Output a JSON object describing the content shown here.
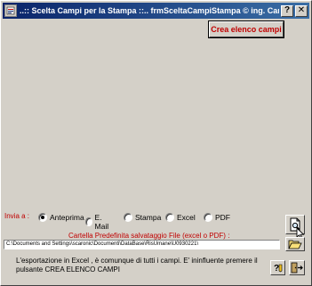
{
  "window": {
    "title": "..:: Scelta Campi per la Stampa ::..    frmSceltaCampiStampa © ing. Carlo Scaroni",
    "help_glyph": "?",
    "close_glyph": "✕"
  },
  "toolbar": {
    "crea_label": "Crea elenco campi"
  },
  "invia": {
    "label": "Invia a :",
    "options": [
      {
        "label": "Anteprima",
        "checked": true
      },
      {
        "label": "E. Mail",
        "checked": false
      },
      {
        "label": "Stampa",
        "checked": false
      },
      {
        "label": "Excel",
        "checked": false
      },
      {
        "label": "PDF",
        "checked": false
      }
    ]
  },
  "cartella": {
    "label": "Cartella Predefinita salvataggio File (excel o PDF) :",
    "path": "C:\\Documents and Settings\\scaronic\\Documenti\\DataBase\\RisUmane\\U0930221\\"
  },
  "info": {
    "line1": "L'esportazione in Excel , è comunque di tutti i campi.  E' ininfluente premere il",
    "line2": "pulsante CREA ELENCO CAMPI"
  },
  "colors": {
    "accent_red": "#c00000",
    "titlebar": "#0a246a",
    "face": "#d4d0c8"
  },
  "icons": [
    "app-icon",
    "help-caption-icon",
    "close-icon",
    "print-preview-icon",
    "folder-open-icon",
    "help-icon",
    "exit-door-icon",
    "mouse-cursor-icon"
  ]
}
